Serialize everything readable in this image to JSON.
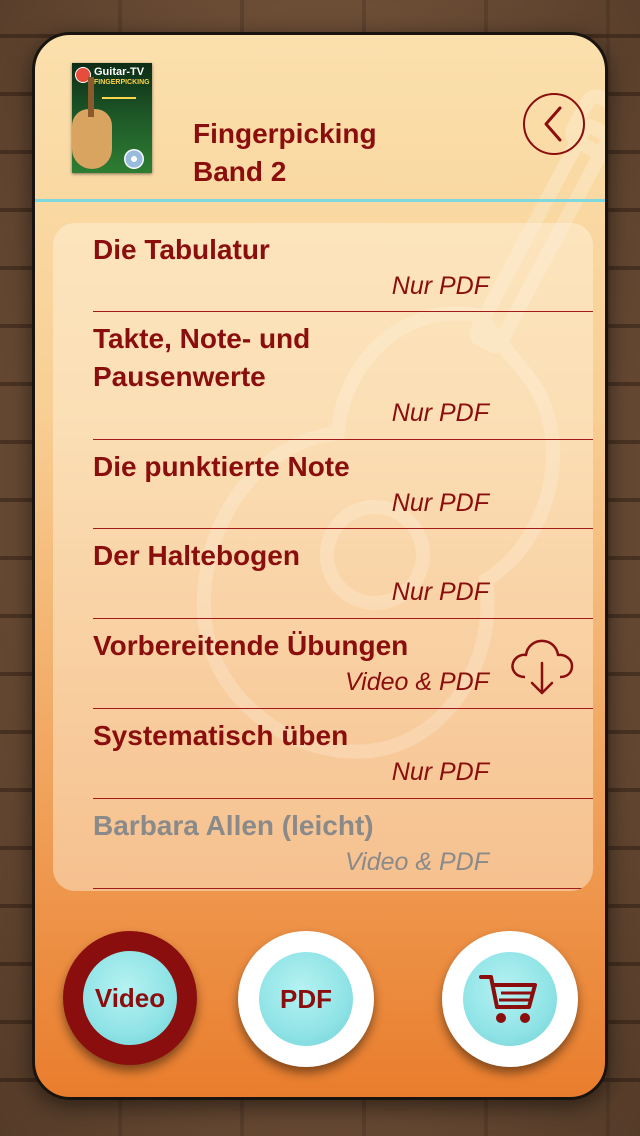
{
  "header": {
    "title_line1": "Fingerpicking",
    "title_line2": "Band 2",
    "cover": {
      "brand": "Guitar-TV",
      "subtitle": "FINGERPICKING"
    }
  },
  "lessons": [
    {
      "title": "Die Tabulatur",
      "type": "Nur PDF",
      "enabled": true,
      "download": false
    },
    {
      "title_line1": "Takte, Note- und",
      "title_line2": "Pausenwerte",
      "type": "Nur PDF",
      "enabled": true,
      "download": false
    },
    {
      "title": "Die punktierte Note",
      "type": "Nur PDF",
      "enabled": true,
      "download": false
    },
    {
      "title": "Der Haltebogen",
      "type": "Nur PDF",
      "enabled": true,
      "download": false
    },
    {
      "title": "Vorbereitende Übungen",
      "type": "Video & PDF",
      "enabled": true,
      "download": true
    },
    {
      "title": "Systematisch üben",
      "type": "Nur PDF",
      "enabled": true,
      "download": false
    },
    {
      "title": "Barbara Allen (leicht)",
      "type": "Video & PDF",
      "enabled": false,
      "download": false
    }
  ],
  "buttons": {
    "video_label": "Video",
    "pdf_label": "PDF"
  },
  "colors": {
    "accent": "#8b0e0e",
    "cyan": "#8fe3e6",
    "divider": "#7fd9dc"
  },
  "icons": [
    "back-chevron-icon",
    "cloud-download-icon",
    "shopping-cart-icon"
  ]
}
